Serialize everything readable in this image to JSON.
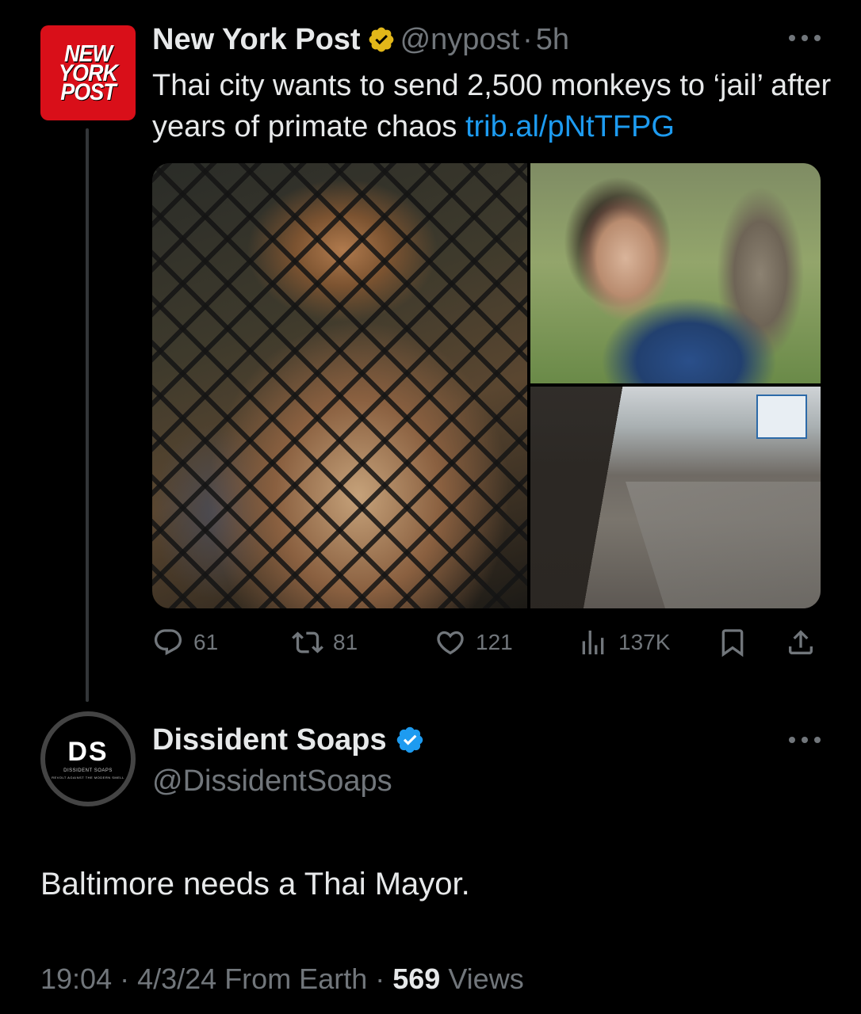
{
  "original_tweet": {
    "avatar_text": [
      "NEW",
      "YORK",
      "POST"
    ],
    "name": "New York Post",
    "verified": "gold",
    "handle": "@nypost",
    "separator": "·",
    "age": "5h",
    "text": "Thai city wants to send 2,500 monkeys to ‘jail’ after years of primate chaos ",
    "link": "trib.al/pNtTFPG",
    "actions": {
      "replies": "61",
      "reposts": "81",
      "likes": "121",
      "views": "137K"
    }
  },
  "reply_tweet": {
    "avatar_text": "DS",
    "avatar_subtext": "DISSIDENT SOAPS",
    "avatar_subtext2": "REVOLT AGAINST THE MODERN SMELL",
    "name": "Dissident Soaps",
    "verified": "blue",
    "handle": "@DissidentSoaps",
    "text": "Baltimore needs a Thai Mayor.",
    "time": "19:04",
    "sep1": " · ",
    "date": "4/3/24",
    "source": " From Earth",
    "sep2": " · ",
    "views_count": "569",
    "views_label": " Views"
  },
  "colors": {
    "background": "#000000",
    "text": "#e7e9ea",
    "muted": "#71767b",
    "link": "#1d9bf0",
    "gold_badge": "#e2b719",
    "blue_badge": "#1d9bf0",
    "nyp_red": "#d90f19"
  }
}
